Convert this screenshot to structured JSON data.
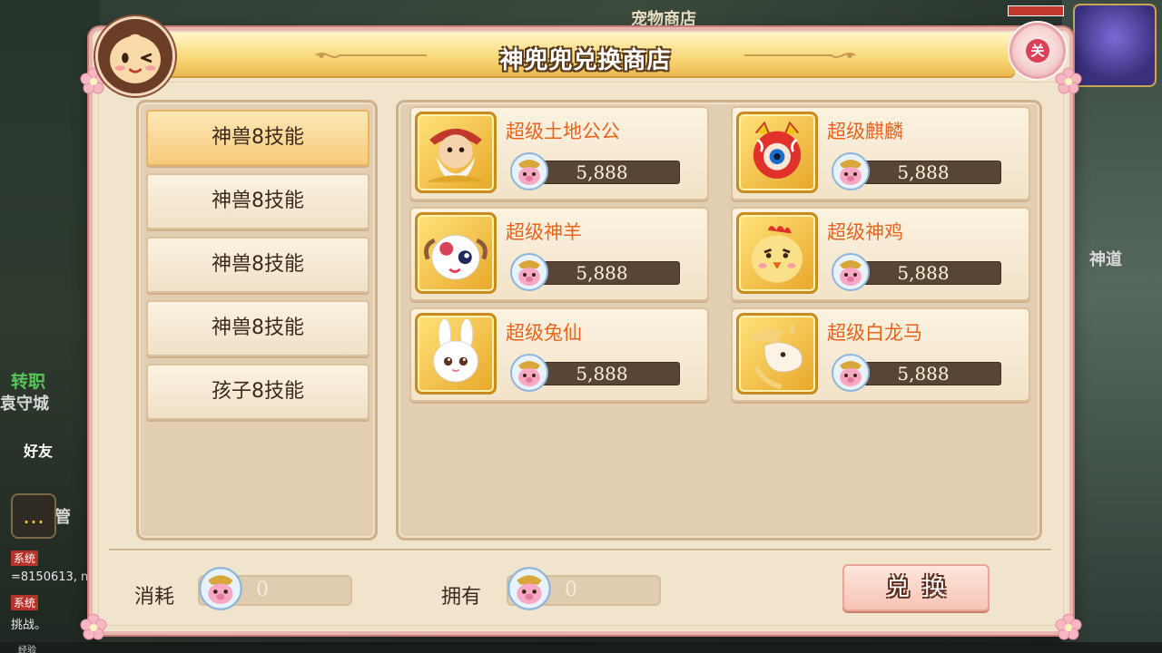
{
  "background": {
    "shop_sign": "宠物商店",
    "job_label": "转职",
    "city_label": "袁守城",
    "friend_label": "好友",
    "manage_label": "管",
    "road_label": "神道",
    "sys_uid": "=8150613, n",
    "sys_badge": "系统",
    "sys_challenge": "挑战。",
    "exp_label": "经验"
  },
  "window": {
    "title": "神兜兜兑换商店",
    "close_label": "关"
  },
  "categories": [
    {
      "label": "神兽8技能",
      "active": true
    },
    {
      "label": "神兽8技能",
      "active": false
    },
    {
      "label": "神兽8技能",
      "active": false
    },
    {
      "label": "神兽8技能",
      "active": false
    },
    {
      "label": "孩子8技能",
      "active": false
    }
  ],
  "items": [
    {
      "name": "超级土地公公",
      "price": "5,888",
      "icon": "earth-god-icon"
    },
    {
      "name": "超级麒麟",
      "price": "5,888",
      "icon": "qilin-icon"
    },
    {
      "name": "超级神羊",
      "price": "5,888",
      "icon": "sheep-icon"
    },
    {
      "name": "超级神鸡",
      "price": "5,888",
      "icon": "rooster-icon"
    },
    {
      "name": "超级兔仙",
      "price": "5,888",
      "icon": "rabbit-icon"
    },
    {
      "name": "超级白龙马",
      "price": "5,888",
      "icon": "white-dragon-horse-icon"
    }
  ],
  "footer": {
    "cost_label": "消耗",
    "cost_value": "0",
    "own_label": "拥有",
    "own_value": "0",
    "exchange_label": "兑换"
  },
  "colors": {
    "item_name": "#e8641d",
    "price_bar": "#584534",
    "panel": "#e2ceb3",
    "window": "#f1e4cd"
  }
}
